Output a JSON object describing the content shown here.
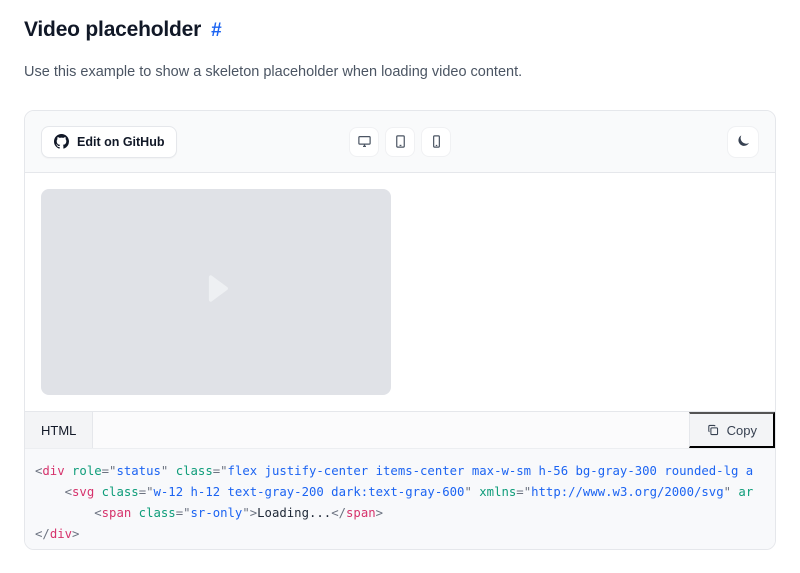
{
  "header": {
    "title": "Video placeholder",
    "anchor": "#",
    "description": "Use this example to show a skeleton placeholder when loading video content."
  },
  "toolbar": {
    "github_button": {
      "label": "Edit on GitHub",
      "icon": "github-icon"
    },
    "devices": [
      {
        "name": "desktop",
        "icon": "desktop-icon"
      },
      {
        "name": "tablet",
        "icon": "tablet-icon"
      },
      {
        "name": "mobile",
        "icon": "mobile-icon"
      }
    ],
    "theme_toggle": {
      "name": "dark-mode",
      "icon": "moon-icon"
    }
  },
  "preview": {
    "skeleton": {
      "icon": "play-icon",
      "bg_color": "#e0e2e7",
      "icon_color": "#eef0f3"
    }
  },
  "code_panel": {
    "tab_label": "HTML",
    "copy_label": "Copy",
    "copy_icon": "copy-icon",
    "lines": [
      {
        "indent": 0,
        "tokens": [
          {
            "t": "punct",
            "v": "<"
          },
          {
            "t": "tag",
            "v": "div"
          },
          {
            "t": "punct",
            "v": " "
          },
          {
            "t": "attr",
            "v": "role"
          },
          {
            "t": "punct",
            "v": "=\""
          },
          {
            "t": "val",
            "v": "status"
          },
          {
            "t": "punct",
            "v": "\" "
          },
          {
            "t": "attr",
            "v": "class"
          },
          {
            "t": "punct",
            "v": "=\""
          },
          {
            "t": "val",
            "v": "flex justify-center items-center max-w-sm h-56 bg-gray-300 rounded-lg a"
          }
        ]
      },
      {
        "indent": 4,
        "tokens": [
          {
            "t": "punct",
            "v": "<"
          },
          {
            "t": "tag",
            "v": "svg"
          },
          {
            "t": "punct",
            "v": " "
          },
          {
            "t": "attr",
            "v": "class"
          },
          {
            "t": "punct",
            "v": "=\""
          },
          {
            "t": "val",
            "v": "w-12 h-12 text-gray-200 dark:text-gray-600"
          },
          {
            "t": "punct",
            "v": "\" "
          },
          {
            "t": "attr",
            "v": "xmlns"
          },
          {
            "t": "punct",
            "v": "=\""
          },
          {
            "t": "val",
            "v": "http://www.w3.org/2000/svg"
          },
          {
            "t": "punct",
            "v": "\" "
          },
          {
            "t": "attr",
            "v": "ar"
          }
        ]
      },
      {
        "indent": 8,
        "tokens": [
          {
            "t": "punct",
            "v": "<"
          },
          {
            "t": "tag",
            "v": "span"
          },
          {
            "t": "punct",
            "v": " "
          },
          {
            "t": "attr",
            "v": "class"
          },
          {
            "t": "punct",
            "v": "=\""
          },
          {
            "t": "val",
            "v": "sr-only"
          },
          {
            "t": "punct",
            "v": "\">"
          },
          {
            "t": "text",
            "v": "Loading..."
          },
          {
            "t": "punct",
            "v": "</"
          },
          {
            "t": "tag",
            "v": "span"
          },
          {
            "t": "punct",
            "v": ">"
          }
        ]
      },
      {
        "indent": 0,
        "tokens": [
          {
            "t": "punct",
            "v": "</"
          },
          {
            "t": "tag",
            "v": "div"
          },
          {
            "t": "punct",
            "v": ">"
          }
        ]
      }
    ]
  },
  "colors": {
    "accent": "#1c64f2",
    "border": "#e5e7eb",
    "toolbar_bg": "#f9fafb",
    "code_bg": "#f8f9fb"
  }
}
